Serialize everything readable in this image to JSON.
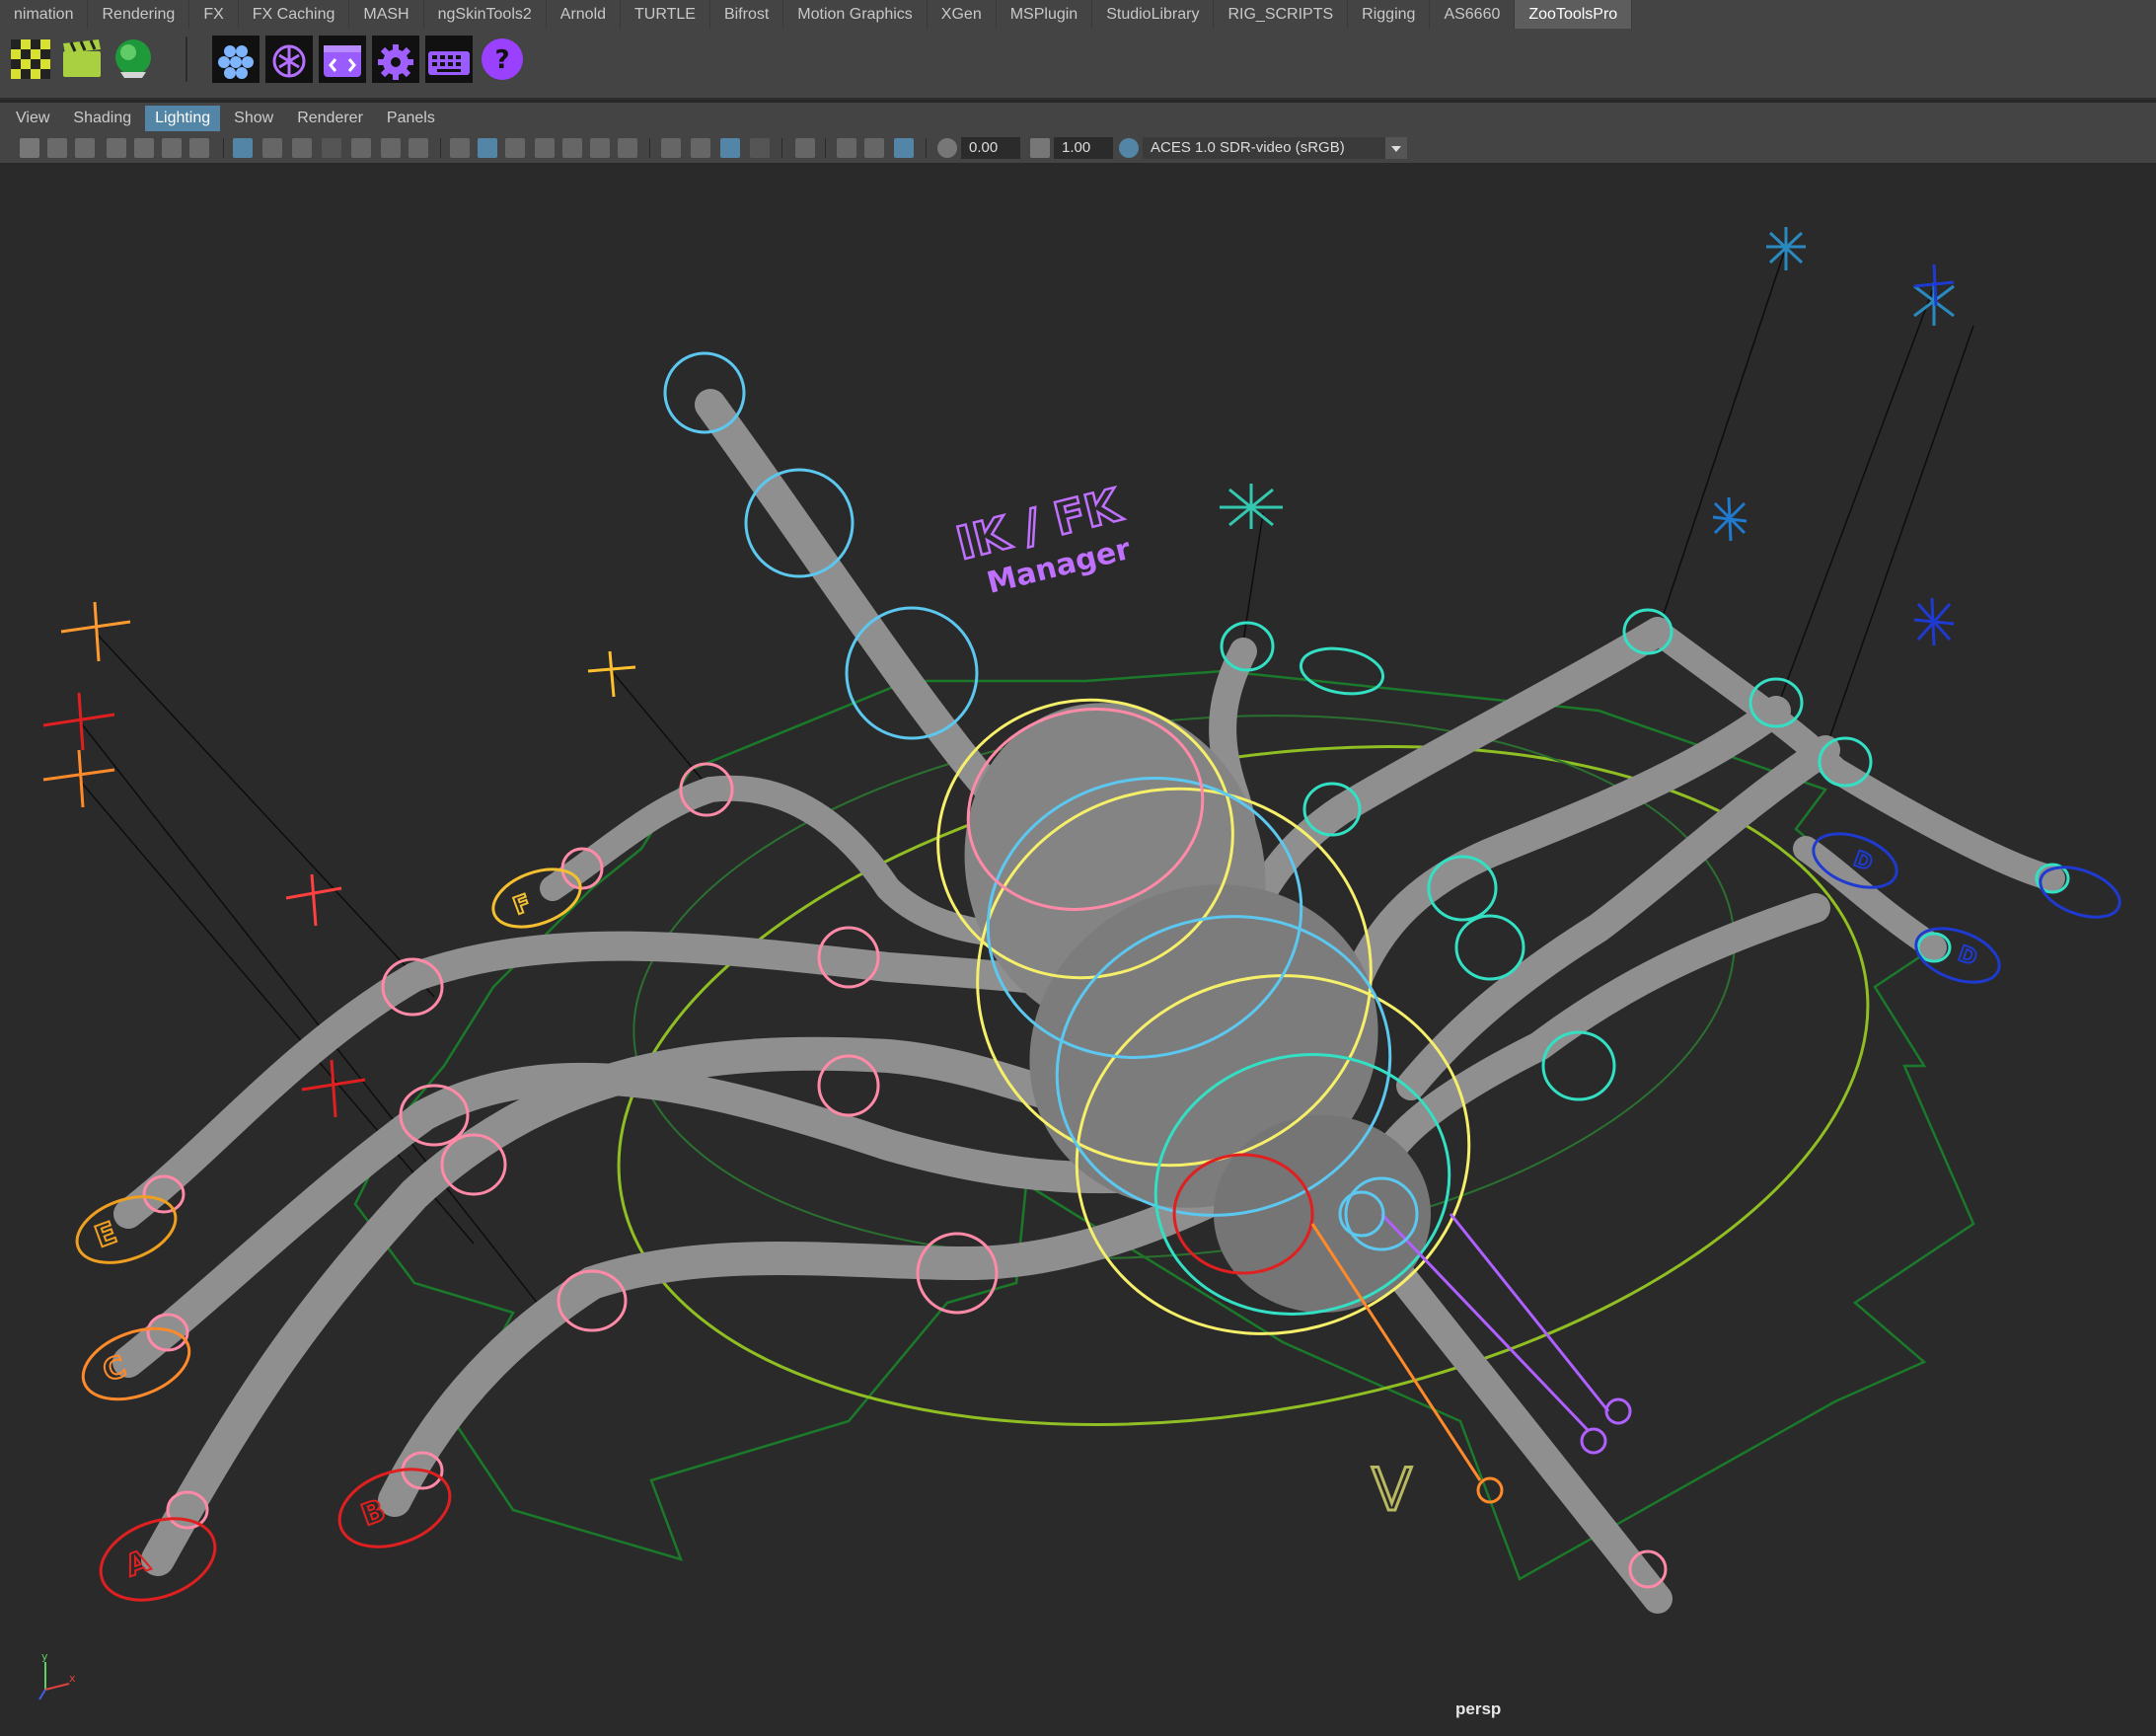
{
  "shelf_tabs": [
    "nimation",
    "Rendering",
    "FX",
    "FX Caching",
    "MASH",
    "ngSkinTools2",
    "Arnold",
    "TURTLE",
    "Bifrost",
    "Motion Graphics",
    "XGen",
    "MSPlugin",
    "StudioLibrary",
    "RIG_SCRIPTS",
    "Rigging",
    "AS6660",
    "ZooToolsPro"
  ],
  "active_tab_index": 16,
  "shelf_icons": [
    "checker-icon",
    "clapperboard-icon",
    "green-sphere-icon",
    "hive-icon",
    "openai-icon",
    "code-window-icon",
    "gear-icon",
    "keyboard-icon",
    "help-icon"
  ],
  "panel_menu": [
    "View",
    "Shading",
    "Lighting",
    "Show",
    "Renderer",
    "Panels"
  ],
  "active_menu_index": 2,
  "toolbar": {
    "exposure_value": "0.00",
    "gamma_value": "1.00",
    "color_transform": "ACES 1.0 SDR-video (sRGB)"
  },
  "viewport": {
    "camera_label": "persp",
    "annotation_title": "IK / FK",
    "annotation_subtitle": "Manager",
    "foot_labels": [
      "A",
      "B",
      "C",
      "E",
      "F",
      "D",
      "D"
    ],
    "body_label": "V",
    "axis_y": "y",
    "axis_x": "x"
  },
  "colors": {
    "accent_blue": "#5285a6",
    "leg_mesh": "#8f8f8f",
    "ctrl_pink": "#ff8aa8",
    "ctrl_cyan": "#33e0c4",
    "ctrl_yellow": "#f5ef6a",
    "ctrl_green": "#1a7a2a",
    "ctrl_lime": "#9acd20",
    "ctrl_red": "#e02020",
    "ctrl_orange": "#ff8a2a",
    "ctrl_purple": "#b060ff",
    "ctrl_blue": "#2050e0",
    "ctrl_lightblue": "#5cc8f0"
  }
}
